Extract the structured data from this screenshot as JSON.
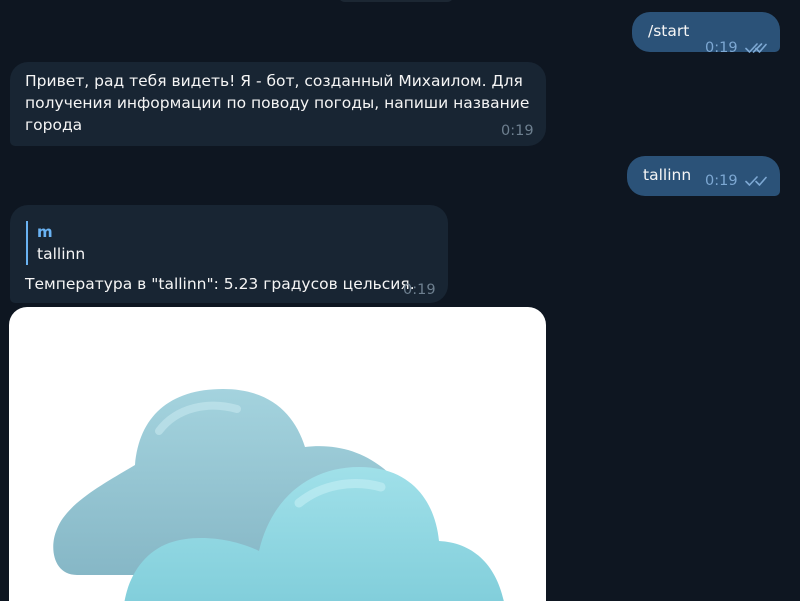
{
  "messages": [
    {
      "id": "out-1",
      "direction": "outgoing",
      "text": "/start",
      "time": "0:19",
      "status_icon": "double-check-icon"
    },
    {
      "id": "in-1",
      "direction": "incoming",
      "text": "Привет, рад тебя видеть! Я - бот, созданный Михаилом. Для\nполучения информации по поводу погоды, напиши название\nгорода",
      "time": "0:19"
    },
    {
      "id": "out-2",
      "direction": "outgoing",
      "text": "tallinn",
      "time": "0:19",
      "status_icon": "double-check-icon"
    },
    {
      "id": "in-2",
      "direction": "incoming",
      "reply": {
        "author": "m",
        "text": "tallinn"
      },
      "text": "Температура в \"tallinn\": 5.23 градусов цельсия.",
      "time": "0:19"
    },
    {
      "id": "in-3",
      "direction": "incoming",
      "attachment_icon": "clouds-weather-icon"
    }
  ],
  "colors": {
    "background": "#0e1621",
    "outgoing_bubble": "#2b5278",
    "incoming_bubble": "#182533",
    "accent": "#6ab3f3",
    "outgoing_time": "#7da8d3",
    "incoming_time": "#6d7f8f"
  }
}
